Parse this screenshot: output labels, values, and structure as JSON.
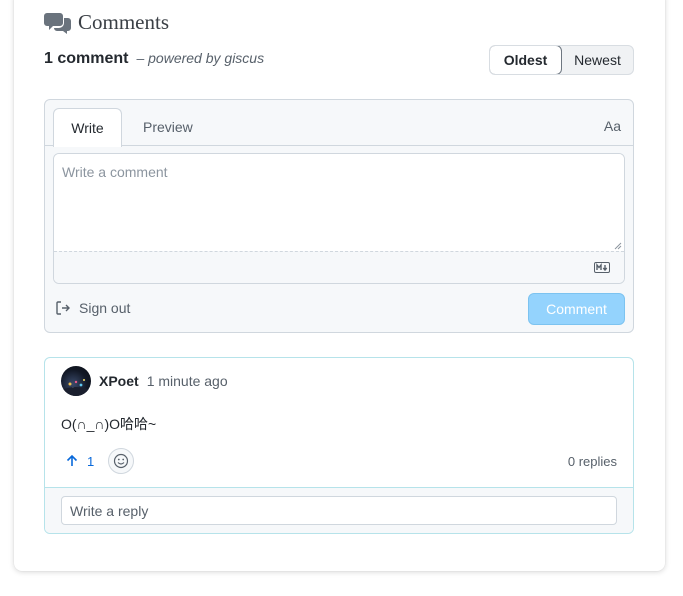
{
  "header": {
    "title": "Comments",
    "count_label": "1 comment",
    "powered_by": "– powered by giscus"
  },
  "sort": {
    "options": [
      "Oldest",
      "Newest"
    ],
    "selected": "Oldest"
  },
  "editor": {
    "tabs": [
      "Write",
      "Preview"
    ],
    "active_tab": "Write",
    "text_size_label": "Aa",
    "placeholder": "Write a comment",
    "value": "",
    "markdown_icon": "markdown-icon",
    "sign_out_label": "Sign out",
    "submit_label": "Comment"
  },
  "comments": [
    {
      "author": "XPoet",
      "time": "1 minute ago",
      "body": "O(∩_∩)O哈哈~",
      "upvotes": "1",
      "replies_label": "0 replies",
      "reply_placeholder": "Write a reply"
    }
  ],
  "colors": {
    "accent": "#0969da",
    "comment_button": "#94d3fd",
    "comment_border": "#b6e3ea",
    "muted": "#57606a"
  }
}
